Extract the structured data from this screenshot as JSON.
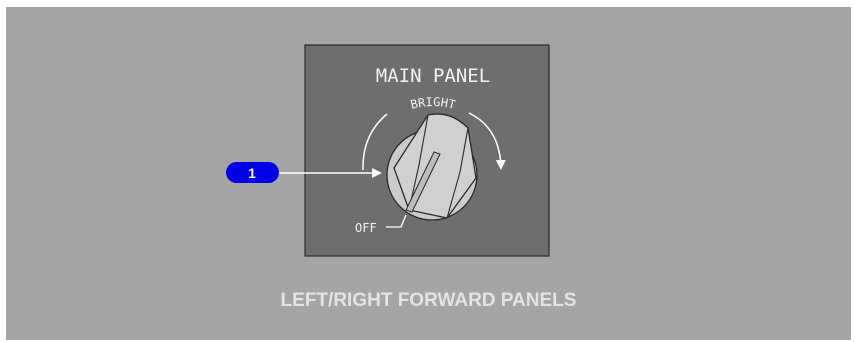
{
  "panel": {
    "title": "MAIN PANEL",
    "bright_label": "BRIGHT",
    "off_label": "OFF"
  },
  "callout": {
    "number": "1"
  },
  "caption": "LEFT/RIGHT FORWARD PANELS",
  "colors": {
    "background": "#a5a5a5",
    "panel": "#6e6e6e",
    "knob": "#cbcbcb",
    "callout": "#0000e6",
    "caption": "#e4e4e4"
  }
}
